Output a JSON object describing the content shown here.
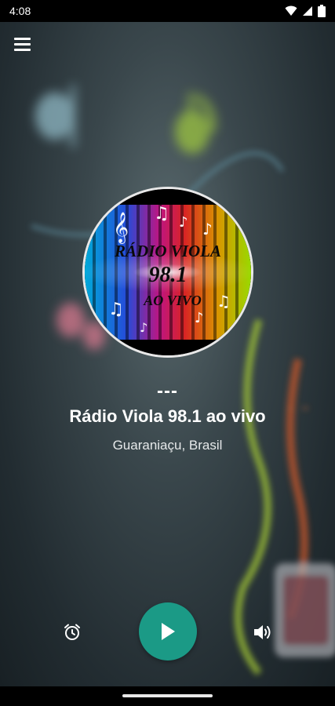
{
  "status_bar": {
    "time": "4:08"
  },
  "header": {
    "menu_icon": "menu-icon"
  },
  "logo": {
    "line1": "RÁDIO VIOLA",
    "line2": "98.1",
    "line3": "AO VIVO"
  },
  "player": {
    "now_playing": "---",
    "station_name": "Rádio Viola 98.1 ao vivo",
    "station_location": "Guaraniaçu, Brasil"
  },
  "controls": {
    "alarm_icon": "alarm-clock-icon",
    "play_icon": "play-icon",
    "volume_icon": "volume-icon"
  },
  "colors": {
    "accent": "#1b9a86",
    "background": "#2c3a3f"
  }
}
